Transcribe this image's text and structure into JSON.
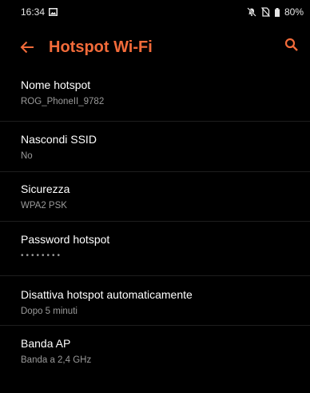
{
  "status_bar": {
    "time": "16:34",
    "battery": "80%",
    "icons": [
      "screenshot-notification-icon",
      "do-not-disturb-icon",
      "no-sim-icon",
      "battery-icon"
    ]
  },
  "app_bar": {
    "title": "Hotspot Wi-Fi",
    "accent_color": "#f26b3a",
    "back_icon": "back-arrow-icon",
    "search_icon": "search-icon"
  },
  "settings": [
    {
      "id": "hotspot-name",
      "title": "Nome hotspot",
      "value": "ROG_PhoneII_9782"
    },
    {
      "id": "hide-ssid",
      "title": "Nascondi SSID",
      "value": "No"
    },
    {
      "id": "security",
      "title": "Sicurezza",
      "value": "WPA2 PSK"
    },
    {
      "id": "hotspot-password",
      "title": "Password hotspot",
      "value": "••••••••"
    },
    {
      "id": "auto-disable",
      "title": "Disattiva hotspot automaticamente",
      "value": "Dopo 5 minuti"
    },
    {
      "id": "ap-band",
      "title": "Banda AP",
      "value": "Banda a 2,4 GHz"
    }
  ]
}
